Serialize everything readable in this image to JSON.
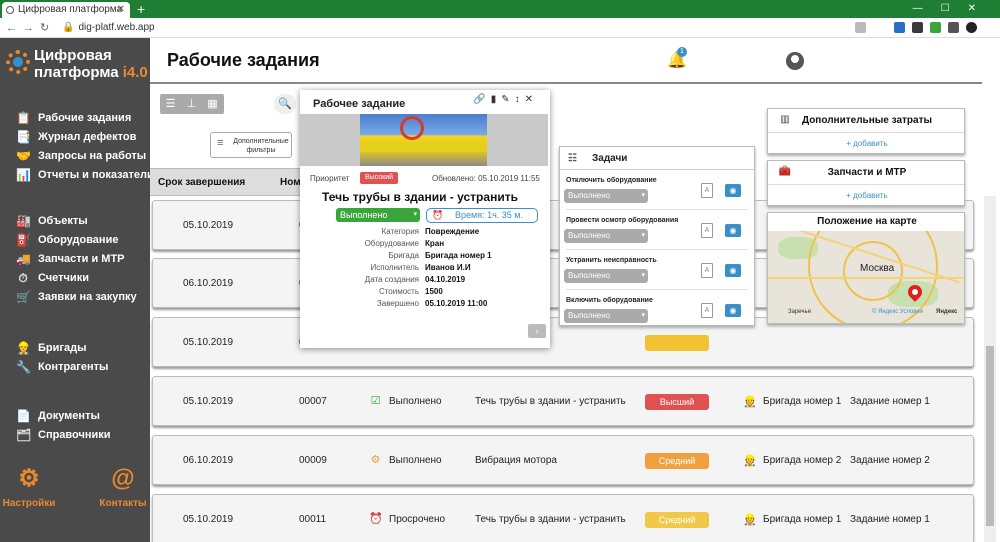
{
  "browser": {
    "tab_title": "Цифровая платформа",
    "tab_close": "✕",
    "new_tab": "+",
    "url": "dig-platf.web.app",
    "window_controls": "—☐✕"
  },
  "brand": {
    "name_line1": "Цифровая",
    "name_line2": "платформа",
    "name_accent": "i4.0",
    "accent_color": "#e88a2e"
  },
  "sidebar": {
    "items": [
      {
        "label": "Рабочие задания",
        "icon": "📋"
      },
      {
        "label": "Журнал дефектов",
        "icon": "📑"
      },
      {
        "label": "Запросы на работы",
        "icon": "🤝"
      },
      {
        "label": "Отчеты и показатели",
        "icon": "📊"
      },
      {
        "label": "Объекты",
        "icon": "🏭"
      },
      {
        "label": "Оборудование",
        "icon": "⛽"
      },
      {
        "label": "Запчасти и МТР",
        "icon": "🚚"
      },
      {
        "label": "Счетчики",
        "icon": "⏱"
      },
      {
        "label": "Заявки на закупку",
        "icon": "🛒"
      },
      {
        "label": "Бригады",
        "icon": "👷"
      },
      {
        "label": "Контрагенты",
        "icon": "🔧"
      },
      {
        "label": "Документы",
        "icon": "📄"
      },
      {
        "label": "Справочники",
        "icon": "🗂"
      }
    ],
    "settings_label": "Настройки",
    "contacts_label": "Контакты"
  },
  "header": {
    "title": "Рабочие задания",
    "notification_count": "1"
  },
  "toolbar": {
    "filter_label_line1": "Дополнительные",
    "filter_label_line2": "фильтры"
  },
  "table": {
    "columns": {
      "deadline": "Срок завершения",
      "number": "Номе"
    },
    "rows": [
      {
        "date": "05.10.2019",
        "num": "00",
        "status": "",
        "task": "",
        "priority": "",
        "priority_color": "#e0e0e0",
        "brigade": "",
        "name": ""
      },
      {
        "date": "06.10.2019",
        "num": "00",
        "status": "",
        "task": "",
        "priority": "",
        "priority_color": "#e0e0e0",
        "brigade": "",
        "name": ""
      },
      {
        "date": "05.10.2019",
        "num": "00",
        "status": "",
        "task": "",
        "priority": "",
        "priority_color": "#f1c232",
        "brigade": "",
        "name": ""
      },
      {
        "date": "05.10.2019",
        "num": "00007",
        "status": "Выполнено",
        "status_icon": "☑",
        "status_color": "#3aa53a",
        "task": "Течь трубы в здании - устранить",
        "priority": "Высший",
        "priority_color": "#e05252",
        "brigade": "Бригада номер 1",
        "name": "Задание номер 1"
      },
      {
        "date": "06.10.2019",
        "num": "00009",
        "status": "Выполнено",
        "status_icon": "⚙",
        "status_color": "#e8a23e",
        "task": "Вибрация мотора",
        "priority": "Средний",
        "priority_color": "#f0a03c",
        "brigade": "Бригада номер 2",
        "name": "Задание номер 2"
      },
      {
        "date": "05.10.2019",
        "num": "00011",
        "status": "Просрочено",
        "status_icon": "⏰",
        "status_color": "#d83a2b",
        "task": "Течь трубы в здании - устранить",
        "priority": "Средний",
        "priority_color": "#f1c84a",
        "brigade": "Бригада номер 1",
        "name": "Задание номер 1"
      }
    ]
  },
  "work_order": {
    "title": "Рабочее задание",
    "priority_label": "Приоритет",
    "priority_value": "Высокий",
    "updated": "Обновлено: 05.10.2019 11:55",
    "job_title": "Течь трубы в здании - устранить",
    "status_value": "Выполнено",
    "time_value": "Время: 1ч. 35 м.",
    "fields": [
      {
        "k": "Категория",
        "v": "Повреждение"
      },
      {
        "k": "Оборудование",
        "v": "Кран"
      },
      {
        "k": "Бригада",
        "v": "Бригада номер 1"
      },
      {
        "k": "Исполнитель",
        "v": "Иванов И.И"
      },
      {
        "k": "Дата создания",
        "v": "04.10.2019"
      },
      {
        "k": "Стоимость",
        "v": "1500"
      },
      {
        "k": "Завершено",
        "v": "05.10.2019 11:00"
      }
    ]
  },
  "tasks_panel": {
    "title": "Задачи",
    "items": [
      {
        "label": "Отключить оборудование",
        "value": "Выполнено"
      },
      {
        "label": "Провести осмотр оборудования",
        "value": "Выполнено"
      },
      {
        "label": "Устранить неисправность",
        "value": "Выполнено"
      },
      {
        "label": "Включить оборудование",
        "value": "Выполнено"
      }
    ]
  },
  "cards": {
    "extra_costs": {
      "title": "Дополнительные затраты",
      "add": "+ добавить"
    },
    "parts": {
      "title": "Запчасти и МТР",
      "add": "+ добавить"
    },
    "map": {
      "title": "Положение на карте",
      "city": "Москва",
      "district": "Заречье",
      "attribution": "© Яндекс Условия",
      "brand": "Яндекс"
    }
  }
}
